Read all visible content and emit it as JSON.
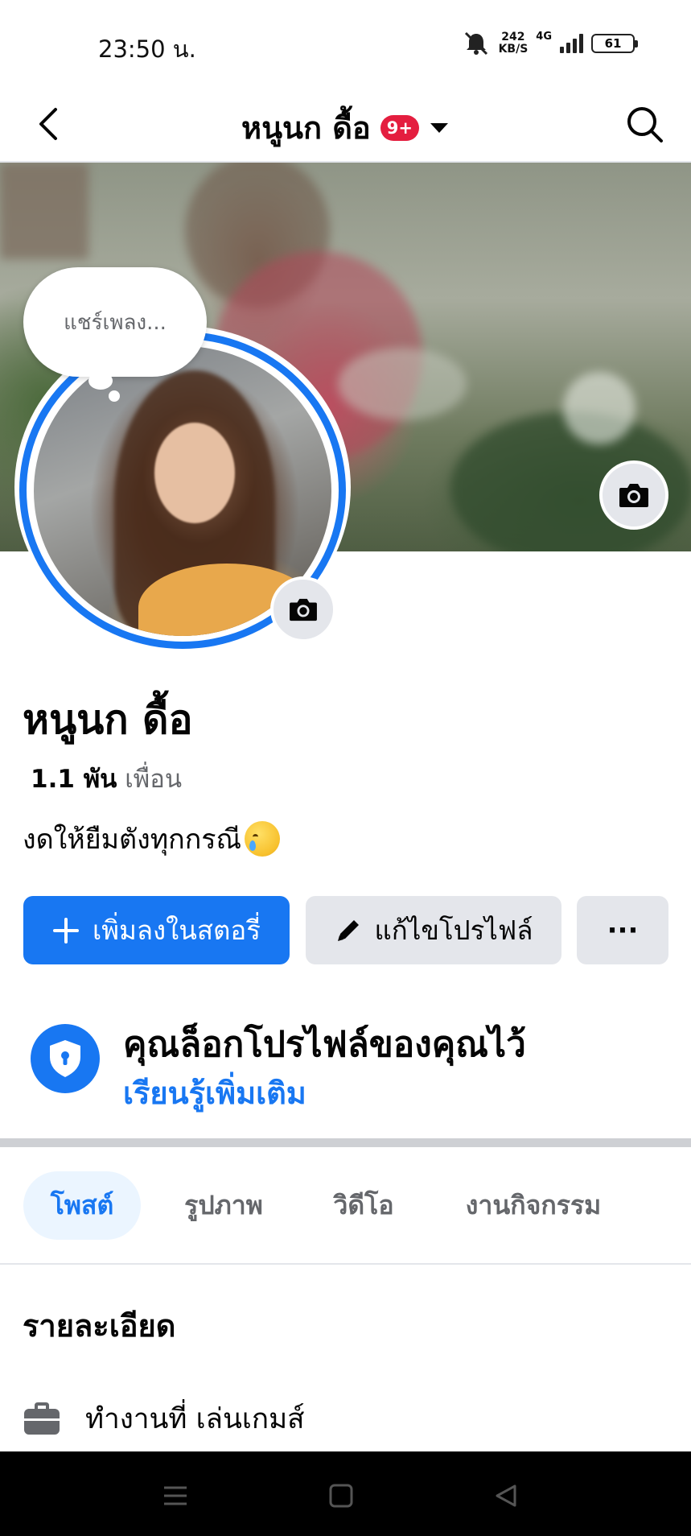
{
  "status_bar": {
    "time": "23:50 น.",
    "net_speed_value": "242",
    "net_speed_unit": "KB/S",
    "network": "4G",
    "battery": "61"
  },
  "nav": {
    "title": "หนูนก ดื้อ",
    "badge": "9+"
  },
  "cover": {
    "camera_icon": "camera-icon"
  },
  "avatar": {
    "bubble_text": "แชร์เพลง..."
  },
  "profile": {
    "name": "หนูนก ดื้อ",
    "friends_count": "1.1 พัน",
    "friends_label": "เพื่อน",
    "bio": "งดให้ยืมตังทุกกรณี"
  },
  "actions": {
    "add_story": "เพิ่มลงในสตอรี่",
    "edit_profile": "แก้ไขโปรไฟล์",
    "more": "···"
  },
  "lock_notice": {
    "title": "คุณล็อกโปรไฟล์ของคุณไว้",
    "link": "เรียนรู้เพิ่มเติม"
  },
  "tabs": [
    {
      "label": "โพสต์",
      "active": true
    },
    {
      "label": "รูปภาพ",
      "active": false
    },
    {
      "label": "วิดีโอ",
      "active": false
    },
    {
      "label": "งานกิจกรรม",
      "active": false
    }
  ],
  "details": {
    "title": "รายละเอียด",
    "work": "ทำงานที่ เล่นเกมส์"
  },
  "colors": {
    "accent": "#1877f2",
    "badge": "#e41e3f",
    "secondary_button": "#e4e6eb"
  }
}
